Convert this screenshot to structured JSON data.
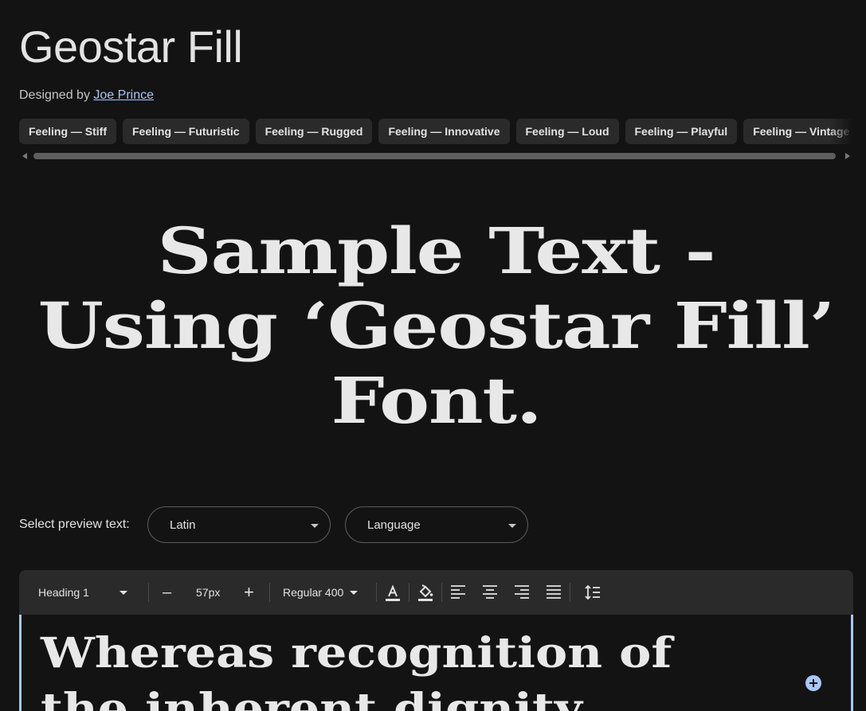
{
  "header": {
    "title": "Geostar Fill",
    "designed_by_prefix": "Designed by",
    "designer_name": "Joe Prince"
  },
  "tags": [
    "Feeling — Stiff",
    "Feeling — Futuristic",
    "Feeling — Rugged",
    "Feeling — Innovative",
    "Feeling — Loud",
    "Feeling — Playful",
    "Feeling — Vintage"
  ],
  "hero": {
    "line1": "Sample Text -",
    "line2": "Using ‘Geostar Fill’",
    "line3": "Font."
  },
  "preview": {
    "label": "Select preview text:",
    "script_value": "Latin",
    "language_value": "Language"
  },
  "toolbar": {
    "style": "Heading 1",
    "decrease": "–",
    "size": "57px",
    "increase": "+",
    "weight": "Regular 400"
  },
  "editor": {
    "line1": "Whereas recognition of",
    "line2": "the inherent dignity"
  },
  "colors": {
    "background": "#131313",
    "accent": "#a8c7fa",
    "toolbar": "#2a2a2a"
  }
}
